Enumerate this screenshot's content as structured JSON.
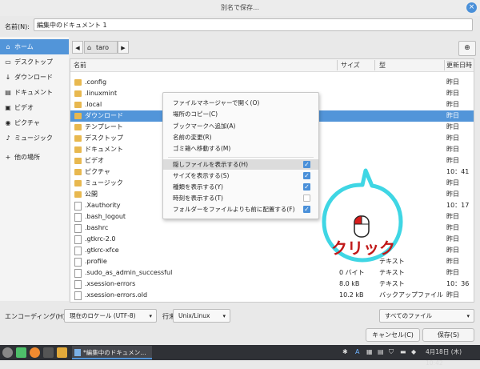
{
  "window": {
    "title": "別名で保存…",
    "close_glyph": "×"
  },
  "name_field": {
    "label": "名前(N):",
    "value": "編集中のドキュメント 1"
  },
  "sidebar": {
    "items": [
      {
        "label": "ホーム",
        "icon": "home-icon",
        "glyph": "⌂",
        "active": true
      },
      {
        "label": "デスクトップ",
        "icon": "desktop-icon",
        "glyph": "▭"
      },
      {
        "label": "ダウンロード",
        "icon": "download-icon",
        "glyph": "↓"
      },
      {
        "label": "ドキュメント",
        "icon": "document-icon",
        "glyph": "▤"
      },
      {
        "label": "ビデオ",
        "icon": "video-icon",
        "glyph": "▣"
      },
      {
        "label": "ピクチャ",
        "icon": "camera-icon",
        "glyph": "◉"
      },
      {
        "label": "ミュージック",
        "icon": "music-icon",
        "glyph": "♪"
      },
      {
        "label": "他の場所",
        "icon": "plus-icon",
        "glyph": "+"
      }
    ]
  },
  "pathbar": {
    "back": "◀",
    "forward": "▶",
    "crumb": "taro",
    "new_folder_glyph": "⊕"
  },
  "columns": {
    "name": "名前",
    "size": "サイズ",
    "type": "型",
    "modified": "更新日時"
  },
  "files": [
    {
      "name": ".config",
      "kind": "folder",
      "size": "",
      "type": "",
      "date": "昨日"
    },
    {
      "name": ".linuxmint",
      "kind": "folder",
      "size": "",
      "type": "",
      "date": "昨日"
    },
    {
      "name": ".local",
      "kind": "folder",
      "size": "",
      "type": "",
      "date": "昨日"
    },
    {
      "name": "ダウンロード",
      "kind": "folder",
      "size": "",
      "type": "",
      "date": "昨日",
      "selected": true
    },
    {
      "name": "テンプレート",
      "kind": "folder",
      "size": "",
      "type": "",
      "date": "昨日"
    },
    {
      "name": "デスクトップ",
      "kind": "folder",
      "size": "",
      "type": "",
      "date": "昨日"
    },
    {
      "name": "ドキュメント",
      "kind": "folder",
      "size": "",
      "type": "",
      "date": "昨日"
    },
    {
      "name": "ビデオ",
      "kind": "folder",
      "size": "",
      "type": "",
      "date": "昨日"
    },
    {
      "name": "ピクチャ",
      "kind": "folder",
      "size": "",
      "type": "",
      "date": "10：41"
    },
    {
      "name": "ミュージック",
      "kind": "folder",
      "size": "",
      "type": "",
      "date": "昨日"
    },
    {
      "name": "公開",
      "kind": "folder",
      "size": "",
      "type": "",
      "date": "昨日"
    },
    {
      "name": ".Xauthority",
      "kind": "file",
      "size": "",
      "type": "",
      "date": "10：17"
    },
    {
      "name": ".bash_logout",
      "kind": "file",
      "size": "",
      "type": "",
      "date": "昨日"
    },
    {
      "name": ".bashrc",
      "kind": "file",
      "size": "",
      "type": "",
      "date": "昨日"
    },
    {
      "name": ".gtkrc-2.0",
      "kind": "file",
      "size": "",
      "type": "",
      "date": "昨日"
    },
    {
      "name": ".gtkrc-xfce",
      "kind": "file",
      "size": "",
      "type": "ト",
      "date": "昨日"
    },
    {
      "name": ".profile",
      "kind": "file",
      "size": "",
      "type": "テキスト",
      "date": "昨日"
    },
    {
      "name": ".sudo_as_admin_successful",
      "kind": "file",
      "size": "0 バイト",
      "type": "テキスト",
      "date": "昨日"
    },
    {
      "name": ".xsession-errors",
      "kind": "file",
      "size": "8.0 kB",
      "type": "テキスト",
      "date": "10：36"
    },
    {
      "name": ".xsession-errors.old",
      "kind": "file",
      "size": "10.2 kB",
      "type": "バックアップファイル",
      "date": "昨日"
    }
  ],
  "context_menu": {
    "items": [
      {
        "label": "ファイルマネージャーで開く(O)"
      },
      {
        "label": "場所のコピー(C)"
      },
      {
        "label": "ブックマークへ追加(A)"
      },
      {
        "label": "名前の変更(R)"
      },
      {
        "label": "ゴミ箱へ移動する(M)"
      }
    ],
    "toggles": [
      {
        "label": "隠しファイルを表示する(H)",
        "checked": true,
        "hover": true
      },
      {
        "label": "サイズを表示する(S)",
        "checked": true
      },
      {
        "label": "種類を表示する(Y)",
        "checked": true
      },
      {
        "label": "時刻を表示する(T)",
        "checked": false
      },
      {
        "label": "フォルダーをファイルよりも前に配置する(F)",
        "checked": true
      }
    ],
    "check_glyph": "✓"
  },
  "bottom": {
    "encoding_label": "エンコーディング(H):",
    "encoding_value": "現在のロケール (UTF-8)",
    "lineend_label": "行末(I):",
    "lineend_value": "Unix/Linux",
    "filter_value": "すべてのファイル",
    "cancel": "キャンセル(C)",
    "save": "保存(S)",
    "arrow": "▾"
  },
  "annotation": {
    "text": "クリック"
  },
  "taskbar": {
    "task_label": "*編集中のドキュメン…",
    "tray_text": "A",
    "clock": "4月18日 (木) 10:42"
  }
}
